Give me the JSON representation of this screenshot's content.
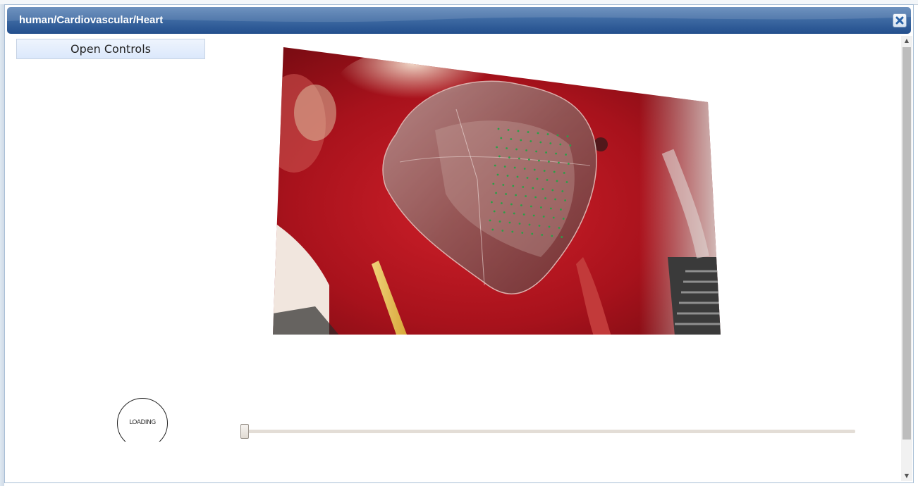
{
  "window": {
    "title": "human/Cardiovascular/Heart",
    "close_icon": "close-icon"
  },
  "controls": {
    "open_label": "Open Controls"
  },
  "viewer": {
    "overlay_icon": "heart-model-overlay"
  },
  "loading": {
    "label": "LOADING"
  },
  "timeline": {
    "position_fraction": 0
  },
  "colors": {
    "titlebar": "#2f5d99",
    "button_bg": "#dbe8fb",
    "tissue_red": "#b5121b",
    "marker_green": "#2a8a3a"
  }
}
